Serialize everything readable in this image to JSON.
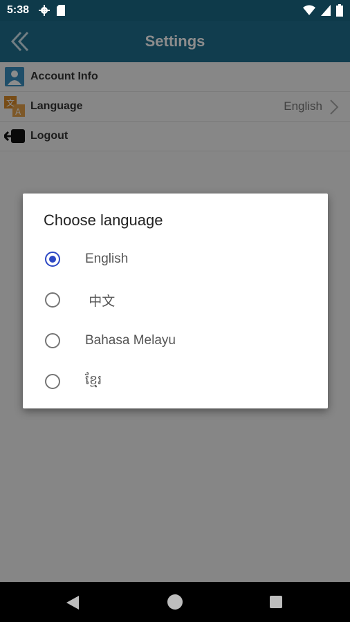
{
  "status_bar": {
    "time": "5:38",
    "icons": [
      "gear-icon",
      "sim-card-icon",
      "wifi-icon",
      "signal-icon",
      "battery-icon"
    ]
  },
  "app_bar": {
    "title": "Settings",
    "back_icon": "double-chevron-left-icon"
  },
  "settings": {
    "items": [
      {
        "label": "Account Info",
        "icon": "account-icon"
      },
      {
        "label": "Language",
        "value": "English",
        "icon": "translate-icon"
      },
      {
        "label": "Logout",
        "icon": "logout-icon"
      }
    ]
  },
  "dialog": {
    "title": "Choose language",
    "options": [
      {
        "label": "English",
        "selected": true
      },
      {
        "label": " 中文",
        "selected": false
      },
      {
        "label": "Bahasa Melayu",
        "selected": false
      },
      {
        "label": "ខ្មែរ",
        "selected": false
      }
    ]
  },
  "colors": {
    "status_bar": "#0e3a4a",
    "app_bar": "#1f6f8f",
    "radio_selected": "#2d48c4"
  }
}
